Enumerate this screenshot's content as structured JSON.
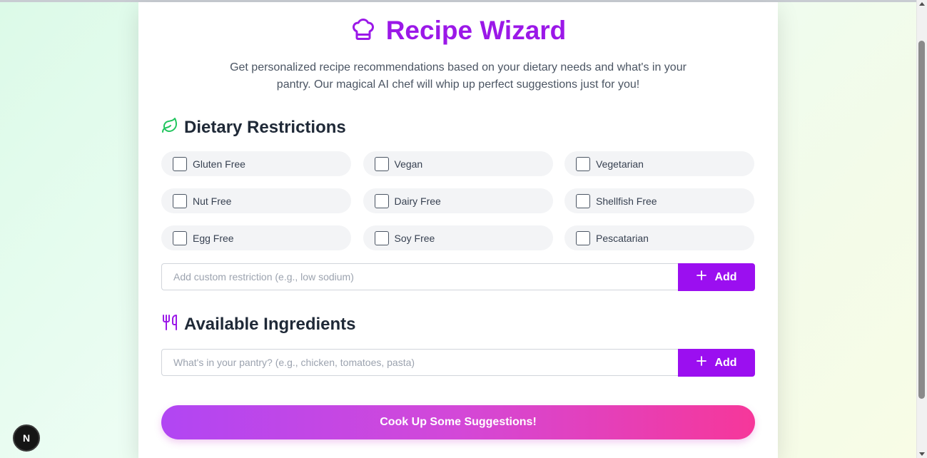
{
  "header": {
    "title": "Recipe Wizard",
    "icon": "chef-hat-icon",
    "subtitle": "Get personalized recipe recommendations based on your dietary needs and what's in your pantry. Our magical AI chef will whip up perfect suggestions just for you!"
  },
  "dietary": {
    "heading": "Dietary Restrictions",
    "icon": "leaf-icon",
    "options": [
      {
        "label": "Gluten Free",
        "checked": false
      },
      {
        "label": "Vegan",
        "checked": false
      },
      {
        "label": "Vegetarian",
        "checked": false
      },
      {
        "label": "Nut Free",
        "checked": false
      },
      {
        "label": "Dairy Free",
        "checked": false
      },
      {
        "label": "Shellfish Free",
        "checked": false
      },
      {
        "label": "Egg Free",
        "checked": false
      },
      {
        "label": "Soy Free",
        "checked": false
      },
      {
        "label": "Pescatarian",
        "checked": false
      }
    ],
    "custom_input": {
      "value": "",
      "placeholder": "Add custom restriction (e.g., low sodium)"
    },
    "add_label": "Add"
  },
  "ingredients": {
    "heading": "Available Ingredients",
    "icon": "utensils-icon",
    "input": {
      "value": "",
      "placeholder": "What's in your pantry? (e.g., chicken, tomatoes, pasta)"
    },
    "add_label": "Add"
  },
  "cook_button": {
    "label": "Cook Up Some Suggestions!"
  },
  "badge": {
    "label": "N"
  },
  "colors": {
    "accent": "#9b0ff0",
    "title": "#9b18e8",
    "leaf": "#22c55e",
    "gradient_start": "#b146f3",
    "gradient_end": "#f6379a"
  }
}
